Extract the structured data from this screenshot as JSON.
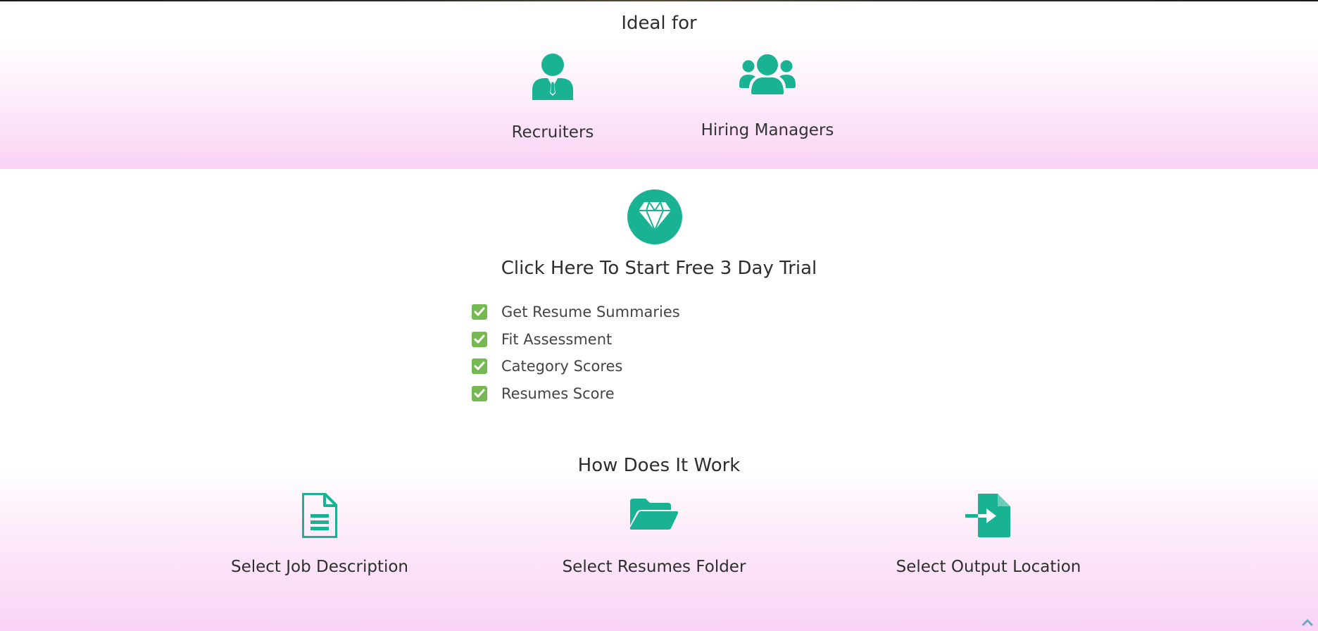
{
  "ideal_for": {
    "title": "Ideal for",
    "audiences": [
      {
        "label": "Recruiters",
        "icon": "user-tie-icon"
      },
      {
        "label": "Hiring Managers",
        "icon": "users-icon"
      }
    ]
  },
  "trial": {
    "icon": "gem-icon",
    "cta_label": "Click Here To Start Free 3 Day Trial",
    "features": [
      {
        "label": "Get Resume Summaries",
        "icon": "check-square-icon"
      },
      {
        "label": "Fit Assessment",
        "icon": "check-square-icon"
      },
      {
        "label": "Category Scores",
        "icon": "check-square-icon"
      },
      {
        "label": "Resumes Score",
        "icon": "check-square-icon"
      }
    ]
  },
  "how_it_works": {
    "title": "How Does It Work",
    "steps": [
      {
        "label": "Select Job Description",
        "icon": "file-text-icon"
      },
      {
        "label": "Select Resumes Folder",
        "icon": "folder-open-icon"
      },
      {
        "label": "Select Output Location",
        "icon": "file-import-icon"
      }
    ]
  },
  "colors": {
    "accent": "#19b394",
    "check": "#76b852",
    "gradient_pink": "#fad2f5"
  },
  "scroll_top_icon": "chevron-up-icon"
}
